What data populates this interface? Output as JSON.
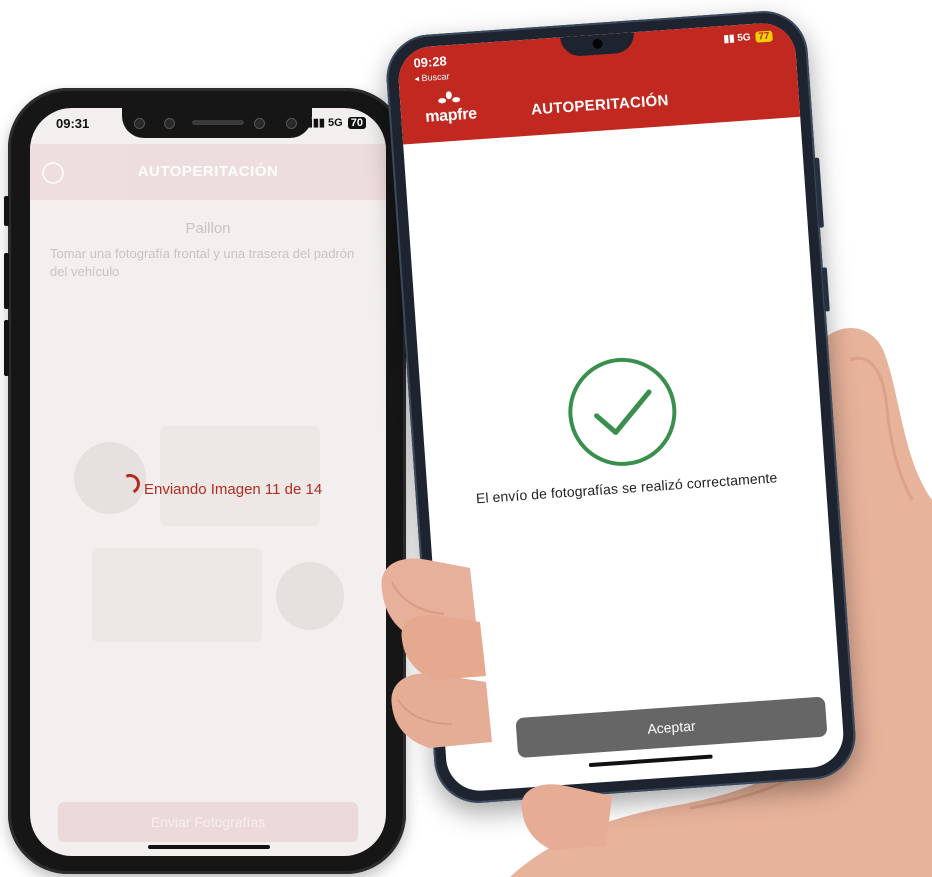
{
  "left_phone": {
    "status_time": "09:31",
    "status_network": "5G",
    "status_battery": "70",
    "header_title": "AUTOPERITACIÓN",
    "faded_title": "Paillon",
    "faded_description": "Tomar una fotografía frontal y una trasera del padrón del vehículo",
    "progress_text": "Enviando Imagen 11 de 14",
    "send_button_label": "Enviar Fotografías"
  },
  "right_phone": {
    "status_time": "09:28",
    "back_label": "◂ Buscar",
    "status_network": "5G",
    "status_battery": "77",
    "brand_name": "mapfre",
    "header_title": "AUTOPERITACIÓN",
    "success_message": "El envío de fotografías se realizó correctamente",
    "accept_button_label": "Aceptar"
  },
  "colors": {
    "brand_red": "#c1281f",
    "success_green": "#3a8f4e",
    "button_grey": "#666666"
  }
}
